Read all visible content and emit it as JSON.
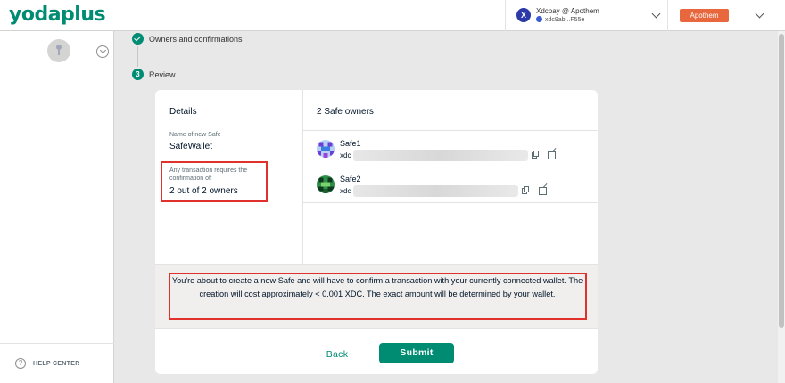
{
  "header": {
    "logo": "yodaplus",
    "account": {
      "avatar_letter": "X",
      "name": "Xdcpay @ Apothem",
      "address": "xdc9ab...F55e"
    },
    "network_label": "Apothem"
  },
  "sidebar": {
    "help_label": "HELP CENTER",
    "help_icon_glyph": "?"
  },
  "stepper": {
    "steps": [
      {
        "number": "",
        "label": "Owners and confirmations",
        "status": "completed"
      },
      {
        "number": "3",
        "label": "Review",
        "status": "active"
      }
    ]
  },
  "details": {
    "title": "Details",
    "name_label": "Name of new Safe",
    "name_value": "SafeWallet",
    "threshold_label_line1": "Any transaction requires the",
    "threshold_label_line2": "confirmation of:",
    "threshold_value": "2 out of 2 owners"
  },
  "owners": {
    "title": "2 Safe owners",
    "list": [
      {
        "name": "Safe1",
        "address_prefix": "xdc"
      },
      {
        "name": "Safe2",
        "address_prefix": "xdc"
      }
    ]
  },
  "info": {
    "message": "You're about to create a new Safe and will have to confirm a transaction with your currently connected wallet. The creation will cost approximately < 0.001 XDC. The exact amount will be determined by your wallet."
  },
  "actions": {
    "back_label": "Back",
    "submit_label": "Submit"
  },
  "colors": {
    "brand": "#008c73",
    "network": "#e8673c",
    "highlight": "#e0312d"
  }
}
